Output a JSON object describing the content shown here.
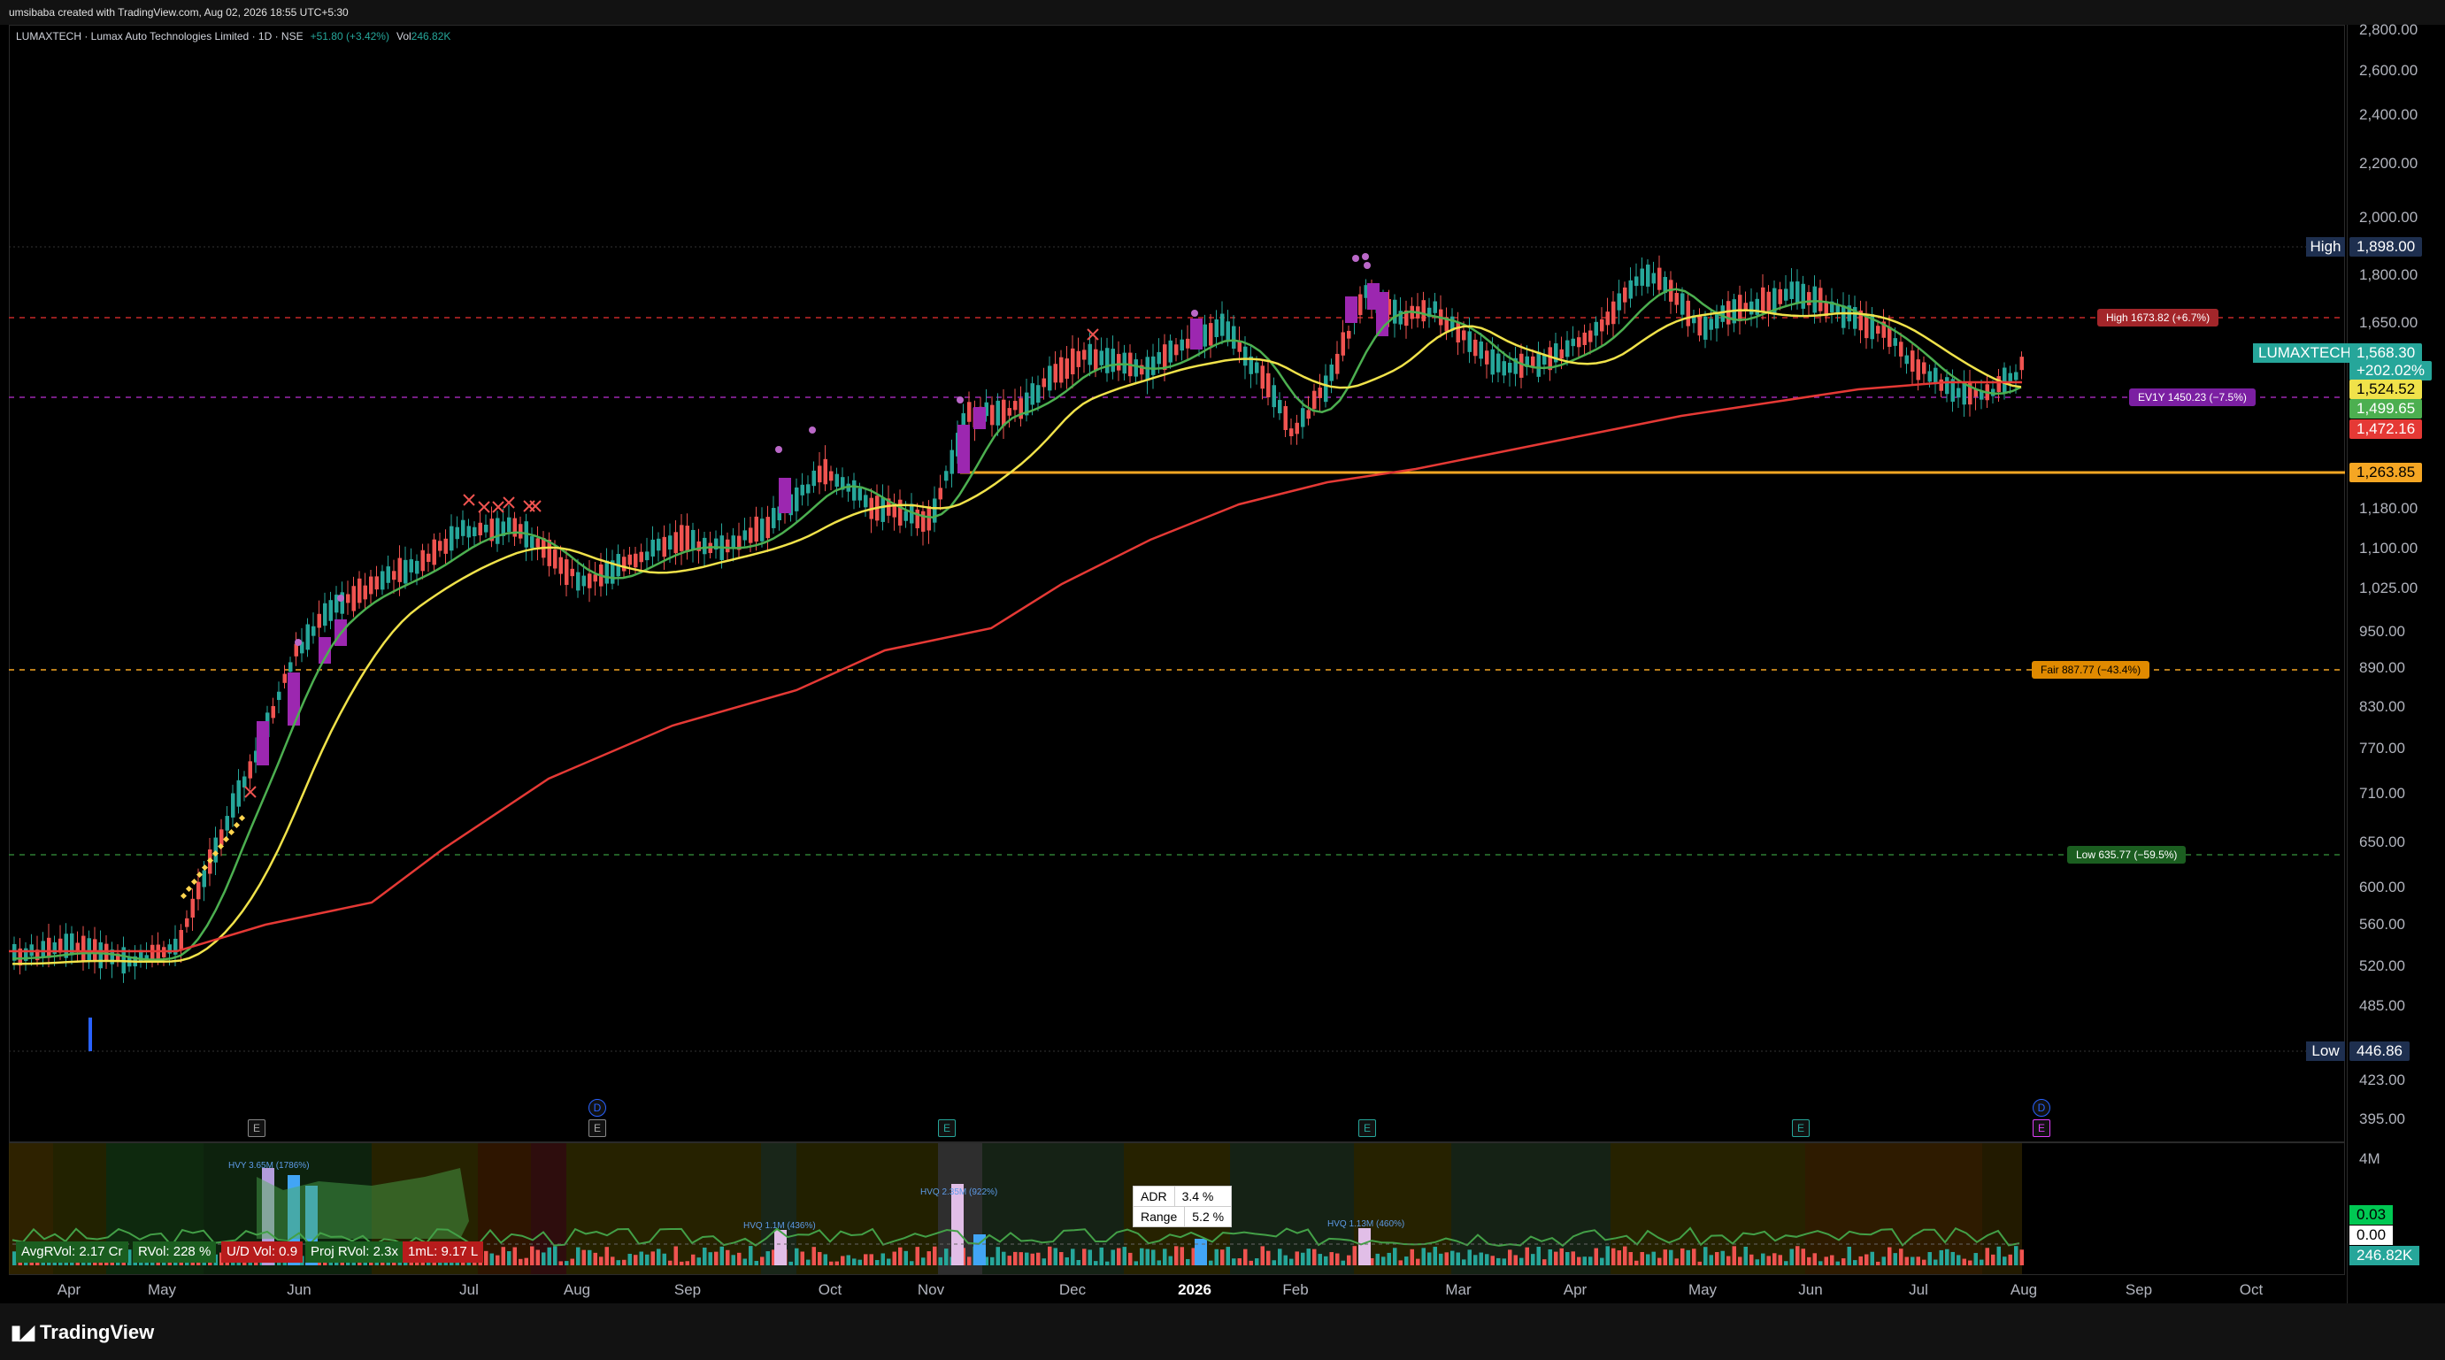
{
  "header": {
    "attribution": "umsibaba created with TradingView.com, Aug 02, 2026 18:55 UTC+5:30"
  },
  "legend": {
    "symbol": "LUMAXTECH · Lumax Auto Technologies Limited · 1D · NSE",
    "change": "+51.80 (+3.42%)",
    "vol_label": "Vol",
    "vol_value": "246.82K"
  },
  "y_axis": {
    "ticks": [
      "2,800.00",
      "2,600.00",
      "2,400.00",
      "2,200.00",
      "2,000.00",
      "1,800.00",
      "1,650.00",
      "1,180.00",
      "1,100.00",
      "1,025.00",
      "950.00",
      "890.00",
      "830.00",
      "770.00",
      "710.00",
      "650.00",
      "600.00",
      "560.00",
      "520.00",
      "485.00",
      "423.00",
      "395.00"
    ]
  },
  "price_tags": {
    "high_label": "High",
    "high_value": "1,898.00",
    "low_label": "Low",
    "low_value": "446.86",
    "ticker": "LUMAXTECH",
    "last_price": "1,568.30",
    "pct_change": "+202.02%",
    "ma_yellow": "1,524.52",
    "ma_green": "1,499.65",
    "ma_red": "1,472.16",
    "support": "1,263.85"
  },
  "price_level_labels": {
    "high": "High 1673.82 (+6.7%)",
    "ev1y": "EV1Y 1450.23 (−7.5%)",
    "fair": "Fair 887.77 (−43.4%)",
    "low": "Low 635.77 (−59.5%)"
  },
  "x_axis": {
    "labels": [
      "Apr",
      "May",
      "Jun",
      "Jul",
      "Aug",
      "Sep",
      "Oct",
      "Nov",
      "Dec",
      "2026",
      "Feb",
      "Mar",
      "Apr",
      "May",
      "Jun",
      "Jul",
      "Aug",
      "Sep",
      "Oct"
    ]
  },
  "event_badges": {
    "earnings": "E",
    "dividend": "D"
  },
  "volume_pane": {
    "scale_top": "4M",
    "val_green": "0.03",
    "val_white": "0.00",
    "val_vol": "246.82K",
    "stats": {
      "avg_vol": "AvgRVol: 2.17 Cr",
      "rvol": "RVol: 228 %",
      "ud_vol": "U/D Vol: 0.9",
      "proj": "Proj RVol: 2.3x",
      "iml": "1mL: 9.17 L"
    },
    "adr_label": "ADR",
    "adr_value": "3.4 %",
    "range_label": "Range",
    "range_value": "5.2 %",
    "hvq_labels": [
      "HVY 3.65M (1786%)",
      "HVQ 1.1M (436%)",
      "HVQ 2.35M (922%)",
      "HVQ 1.13M (460%)"
    ]
  },
  "footer": {
    "brand": "TradingView"
  },
  "colors": {
    "up": "#26a69a",
    "down": "#ef5350",
    "ma_fast": "#4caf50",
    "ma_mid": "#f0e24a",
    "ma_slow": "#e53935",
    "support": "#f5a623",
    "purple": "#9c27b0"
  }
}
